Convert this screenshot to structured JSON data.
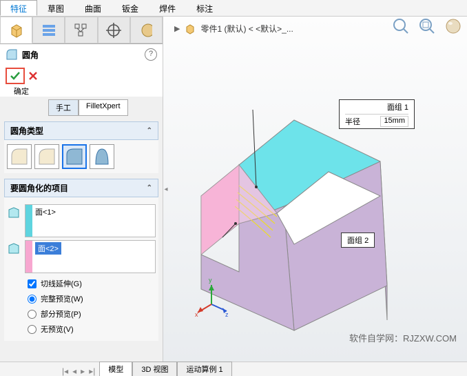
{
  "ribbon": {
    "tabs": [
      "特征",
      "草图",
      "曲面",
      "钣金",
      "焊件",
      "标注"
    ],
    "active_index": 0
  },
  "tree": {
    "part_label": "零件1 (默认) < <默认>_..."
  },
  "feature": {
    "title": "圆角",
    "ok_text": "确定",
    "mode_manual": "手工",
    "mode_xpert": "FilletXpert"
  },
  "sections": {
    "type": {
      "header": "圆角类型"
    },
    "items": {
      "header": "要圆角化的项目",
      "face1": "面<1>",
      "face2": "面<2>"
    },
    "options": {
      "tangent": "切线延伸(G)",
      "full_preview": "完整预览(W)",
      "partial_preview": "部分预览(P)",
      "no_preview": "无预览(V)"
    }
  },
  "callouts": {
    "group_label": "面组",
    "group1_num": "1",
    "radius_label": "半径",
    "radius_value": "15mm",
    "group2_num": "2"
  },
  "bottom_tabs": [
    "模型",
    "3D 视图",
    "运动算例 1"
  ],
  "watermark": "软件自学网：RJZXW.COM",
  "axis": {
    "x": "x",
    "y": "y",
    "z": "z"
  }
}
